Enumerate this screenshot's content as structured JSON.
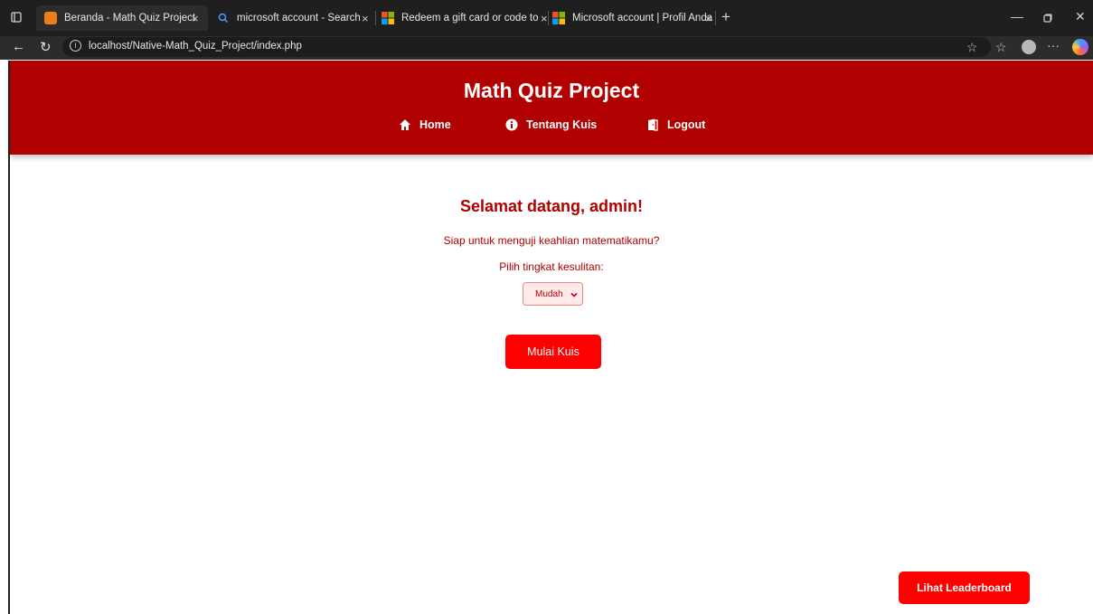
{
  "browser": {
    "tabs": [
      {
        "title": "Beranda - Math Quiz Project",
        "close": "×"
      },
      {
        "title": "microsoft account - Search",
        "close": "×"
      },
      {
        "title": "Redeem a gift card or code to yo",
        "close": "×"
      },
      {
        "title": "Microsoft account | Profil Anda",
        "close": "×"
      }
    ],
    "new_tab": "+",
    "url": "localhost/Native-Math_Quiz_Project/index.php",
    "icons": [
      "tab-actions-icon",
      "back-icon",
      "refresh-icon",
      "info-icon",
      "favorite-star-icon",
      "favorites-icon",
      "profile-icon",
      "more-icon",
      "copilot-icon",
      "minimize-icon",
      "restore-icon",
      "close-window-icon"
    ]
  },
  "header": {
    "title": "Math Quiz Project",
    "nav": [
      {
        "label": "Home",
        "icon": "home-icon"
      },
      {
        "label": "Tentang Kuis",
        "icon": "info-circle-icon"
      },
      {
        "label": "Logout",
        "icon": "door-icon"
      }
    ]
  },
  "main": {
    "welcome": "Selamat datang, admin!",
    "subtitle": "Siap untuk menguji keahlian matematikamu?",
    "difficulty_label": "Pilih tingkat kesulitan:",
    "difficulty_value": "Mudah",
    "start_button": "Mulai Kuis",
    "leaderboard_button": "Lihat Leaderboard"
  },
  "colors": {
    "header_bg": "#b00000",
    "accent": "#ff0000",
    "text_red": "#b00000"
  }
}
